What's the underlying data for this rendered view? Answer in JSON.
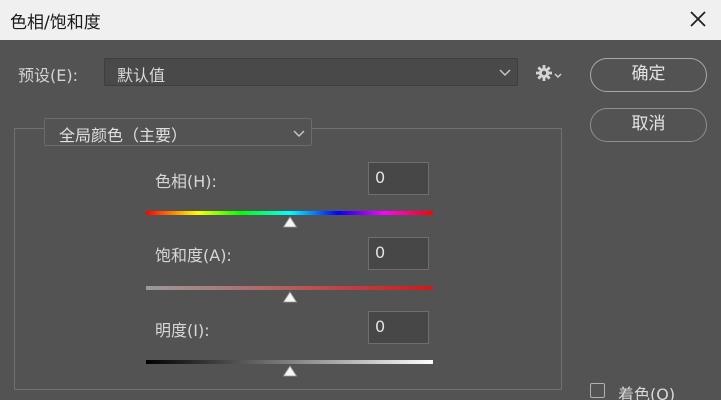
{
  "window": {
    "title": "色相/饱和度"
  },
  "preset": {
    "label": "预设(E):",
    "value": "默认值"
  },
  "buttons": {
    "ok": "确定",
    "cancel": "取消"
  },
  "channel": {
    "value": "全局颜色（主要）"
  },
  "sliders": {
    "hue": {
      "label": "色相(H):",
      "value": "0",
      "position_fraction": 0.5
    },
    "saturation": {
      "label": "饱和度(A):",
      "value": "0",
      "position_fraction": 0.5
    },
    "lightness": {
      "label": "明度(I):",
      "value": "0",
      "position_fraction": 0.5
    }
  },
  "colorize": {
    "label": "着色(O)",
    "checked": false
  },
  "icons": {
    "close": "close-icon",
    "gear": "gear-icon",
    "chevron": "chevron-down-icon"
  },
  "colors": {
    "background": "#535353",
    "titlebar": "#f0f0f0",
    "saturation_end": "#d01818"
  }
}
